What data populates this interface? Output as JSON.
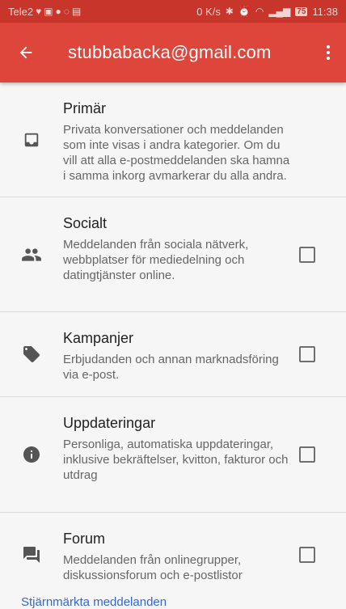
{
  "statusbar": {
    "carrier": "Tele2",
    "speed": "0 K/s",
    "battery": "75",
    "time": "11:38"
  },
  "appbar": {
    "title": "stubbabacka@gmail.com",
    "back_icon": "arrow-back-icon",
    "menu_icon": "more-vert-icon"
  },
  "categories": [
    {
      "title": "Primär",
      "description": "Privata konversationer och meddelanden som inte visas i andra kategorier. Om du vill att alla e-postmeddelanden ska hamna i samma inkorg avmarkerar du alla andra.",
      "icon": "inbox-icon",
      "has_checkbox": false
    },
    {
      "title": "Socialt",
      "description": "Meddelanden från sociala nätverk, webbplatser för mediedelning och datingtjänster online.",
      "icon": "people-icon",
      "has_checkbox": true,
      "checked": false
    },
    {
      "title": "Kampanjer",
      "description": "Erbjudanden och annan marknadsföring via e-post.",
      "icon": "tag-icon",
      "has_checkbox": true,
      "checked": false
    },
    {
      "title": "Uppdateringar",
      "description": "Personliga, automatiska uppdateringar, inklusive bekräftelser, kvitton, fakturor och utdrag",
      "icon": "info-icon",
      "has_checkbox": true,
      "checked": false
    },
    {
      "title": "Forum",
      "description": "Meddelanden från onlinegrupper, diskussionsforum och e-postlistor",
      "icon": "forum-icon",
      "has_checkbox": true,
      "checked": false
    }
  ],
  "footer": {
    "link": "Stjärnmärkta meddelanden"
  },
  "colors": {
    "status_bar": "#c7352b",
    "app_bar": "#de463b",
    "background": "#f6f6f6",
    "link": "#3367d6"
  }
}
